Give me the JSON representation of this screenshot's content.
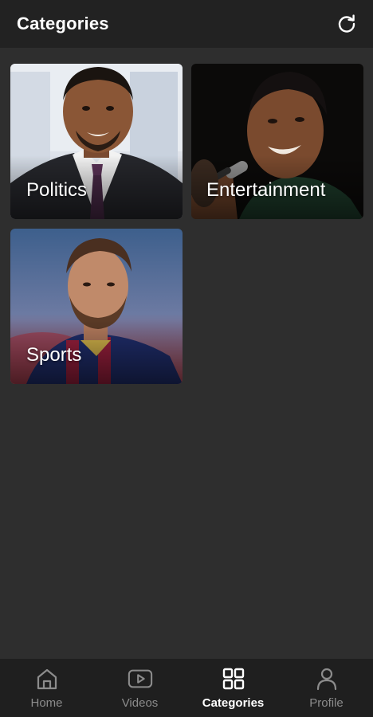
{
  "header": {
    "title": "Categories",
    "refresh_icon": "refresh-icon"
  },
  "categories": [
    {
      "label": "Politics"
    },
    {
      "label": "Entertainment"
    },
    {
      "label": "Sports"
    }
  ],
  "bottom_nav": {
    "items": [
      {
        "label": "Home",
        "icon": "home-icon",
        "active": false
      },
      {
        "label": "Videos",
        "icon": "video-icon",
        "active": false
      },
      {
        "label": "Categories",
        "icon": "grid-icon",
        "active": true
      },
      {
        "label": "Profile",
        "icon": "person-icon",
        "active": false
      }
    ]
  },
  "colors": {
    "background": "#2e2e2e",
    "header": "#222222",
    "nav": "#1f1f1f",
    "active": "#ffffff",
    "inactive": "#8c8c8c"
  }
}
